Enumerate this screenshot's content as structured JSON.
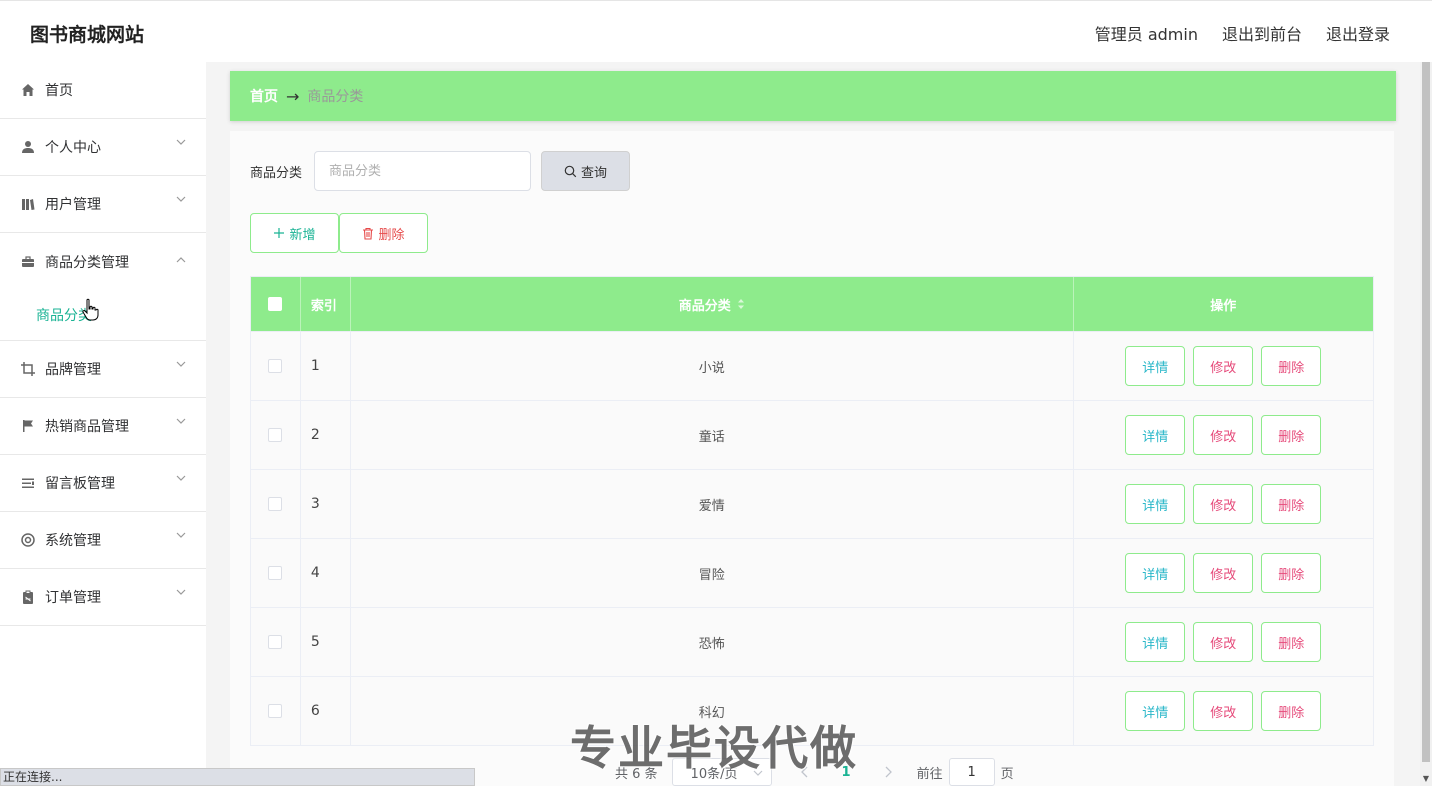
{
  "header": {
    "brand": "图书商城网站",
    "admin_label": "管理员 admin",
    "to_front": "退出到前台",
    "logout": "退出登录"
  },
  "sidebar": {
    "items": [
      {
        "label": "首页",
        "icon": "home-icon"
      },
      {
        "label": "个人中心",
        "icon": "user-icon"
      },
      {
        "label": "用户管理",
        "icon": "library-icon"
      },
      {
        "label": "商品分类管理",
        "icon": "briefcase-icon",
        "expanded": true,
        "children": [
          "商品分类"
        ]
      },
      {
        "label": "品牌管理",
        "icon": "crop-icon"
      },
      {
        "label": "热销商品管理",
        "icon": "flag-icon"
      },
      {
        "label": "留言板管理",
        "icon": "list-icon"
      },
      {
        "label": "系统管理",
        "icon": "lifebuoy-icon"
      },
      {
        "label": "订单管理",
        "icon": "clipboard-icon"
      }
    ]
  },
  "breadcrumb": {
    "home": "首页",
    "arrow": "→",
    "current": "商品分类"
  },
  "search": {
    "label": "商品分类",
    "placeholder": "商品分类",
    "button": "查询"
  },
  "actions": {
    "add": "新增",
    "delete": "删除"
  },
  "table": {
    "headers": {
      "index": "索引",
      "category": "商品分类",
      "ops": "操作"
    },
    "rows": [
      {
        "index": "1",
        "category": "小说"
      },
      {
        "index": "2",
        "category": "童话"
      },
      {
        "index": "3",
        "category": "爱情"
      },
      {
        "index": "4",
        "category": "冒险"
      },
      {
        "index": "5",
        "category": "恐怖"
      },
      {
        "index": "6",
        "category": "科幻"
      }
    ],
    "op_labels": {
      "detail": "详情",
      "edit": "修改",
      "delete": "删除"
    }
  },
  "pagination": {
    "total": "共 6 条",
    "page_size": "10条/页",
    "current_page": "1",
    "goto_label": "前往",
    "goto_value": "1",
    "page_suffix": "页"
  },
  "watermark": "专业毕设代做",
  "status": "正在连接...",
  "colors": {
    "accent_green": "#8eeb8c",
    "teal_text": "#1ab394",
    "detail_text": "#2ab7c9",
    "danger_text": "#e64a7a"
  }
}
